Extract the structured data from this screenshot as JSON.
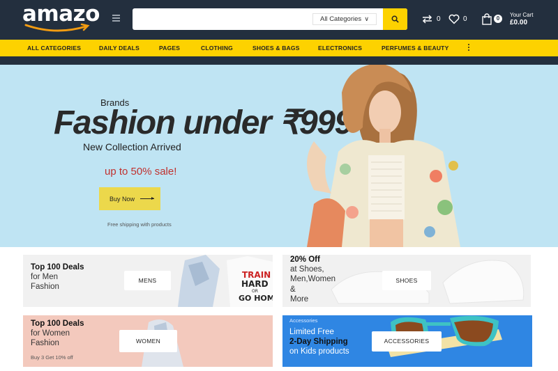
{
  "header": {
    "logo": "amazo",
    "search": {
      "placeholder": "",
      "category": "All Categories"
    },
    "compare_count": "0",
    "wishlist_count": "0",
    "cart": {
      "count": "0",
      "label": "Your Cart",
      "total": "£0.00"
    }
  },
  "nav": {
    "items": [
      "ALL CATEGORIES",
      "DAILY DEALS",
      "PAGES",
      "CLOTHING",
      "SHOES & BAGS",
      "ELECTRONICS",
      "PERFUMES & BEAUTY"
    ]
  },
  "hero": {
    "brands": "Brands",
    "title": "Fashion under ₹999",
    "subtitle": "New Collection Arrived",
    "sale": "up to 50% sale!",
    "button": "Buy Now",
    "note": "Free shipping with products"
  },
  "banners": {
    "men": {
      "line1": "Top 100 Deals",
      "line2": "for Men",
      "line3": "Fashion",
      "button": "MENS",
      "shirt_text": [
        "TRAIN",
        "HARD",
        "OR",
        "GO HOME"
      ]
    },
    "shoes": {
      "line1": "20% Off",
      "line2": "at Shoes,",
      "line3": "Men,Women",
      "line4": "&",
      "line5": "More",
      "button": "SHOES"
    },
    "women": {
      "line1": "Top 100 Deals",
      "line2": "for Women",
      "line3": "Fashion",
      "note": "Buy 3 Get 10% off",
      "button": "WOMEN"
    },
    "accessories": {
      "tag": "Accessories",
      "line1": "Limited Free",
      "line2": "2-Day Shipping",
      "line3": "on Kids products",
      "button": "ACCESSORIES"
    }
  },
  "colors": {
    "header_bg": "#232f3e",
    "accent_yellow": "#fdd200",
    "hero_bg": "#bfe4f3",
    "sale_red": "#c0312e",
    "accessories_blue": "#2f86e3",
    "women_pink": "#f3c9bd"
  }
}
